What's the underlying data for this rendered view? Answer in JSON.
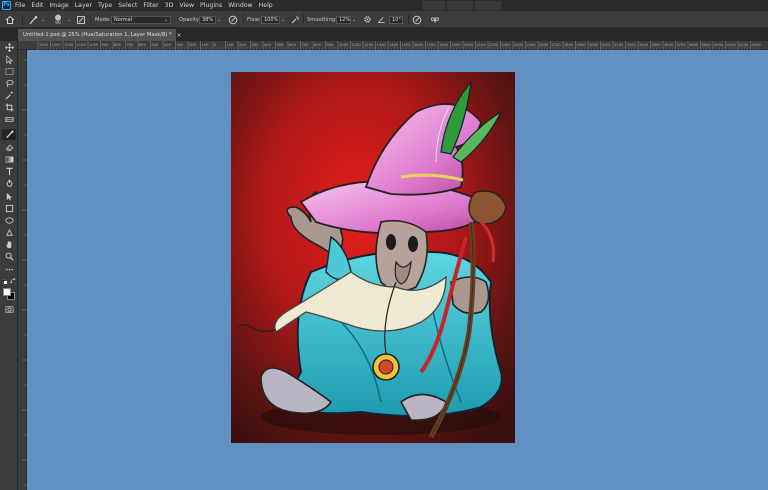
{
  "app": {
    "logo_text": "Ps"
  },
  "menu": {
    "items": [
      "File",
      "Edit",
      "Image",
      "Layer",
      "Type",
      "Select",
      "Filter",
      "3D",
      "View",
      "Plugins",
      "Window",
      "Help"
    ]
  },
  "options_bar": {
    "brush_size": "90",
    "mode_label": "Mode:",
    "mode_value": "Normal",
    "opacity_label": "Opacity:",
    "opacity_value": "38%",
    "flow_label": "Flow:",
    "flow_value": "100%",
    "smoothing_label": "Smoothing:",
    "smoothing_value": "12%",
    "angle_value": "10°"
  },
  "document_tab": {
    "title": "Untitled-1.psd @ 25% (Hue/Saturation 1, Layer Mask/8) *",
    "close_glyph": "×"
  },
  "ruler": {
    "ticks": [
      "1400",
      "1300",
      "1200",
      "1100",
      "1000",
      "900",
      "800",
      "700",
      "600",
      "500",
      "400",
      "300",
      "200",
      "100",
      "0",
      "100",
      "200",
      "300",
      "400",
      "500",
      "600",
      "700",
      "800",
      "900",
      "1000",
      "1100",
      "1200",
      "1300",
      "1400",
      "1500",
      "1600",
      "1700",
      "1800",
      "1900",
      "2000",
      "2100",
      "2200",
      "2300",
      "2400",
      "2500",
      "2600",
      "2700",
      "2800",
      "2900",
      "3000",
      "3100",
      "3200",
      "3300",
      "3400",
      "3500",
      "3600",
      "3700",
      "3800",
      "3900",
      "4000",
      "4100",
      "4200",
      "4300"
    ]
  },
  "toolbar": {
    "tools": [
      "move-tool",
      "artboard-tool",
      "marquee-tool",
      "lasso-tool",
      "magic-wand-tool",
      "crop-tool",
      "eyedropper-tool",
      "healing-tool",
      "brush-tool",
      "clone-stamp-tool",
      "history-brush-tool",
      "eraser-tool",
      "gradient-tool",
      "blur-tool",
      "dodge-tool",
      "pen-tool",
      "type-tool",
      "path-selection-tool",
      "rectangle-tool",
      "hand-tool",
      "zoom-tool",
      "more-tools"
    ],
    "active_tool": "brush-tool"
  },
  "colors": {
    "workspace": "#6190c2",
    "foreground": "#ffffff",
    "background": "#000000"
  }
}
